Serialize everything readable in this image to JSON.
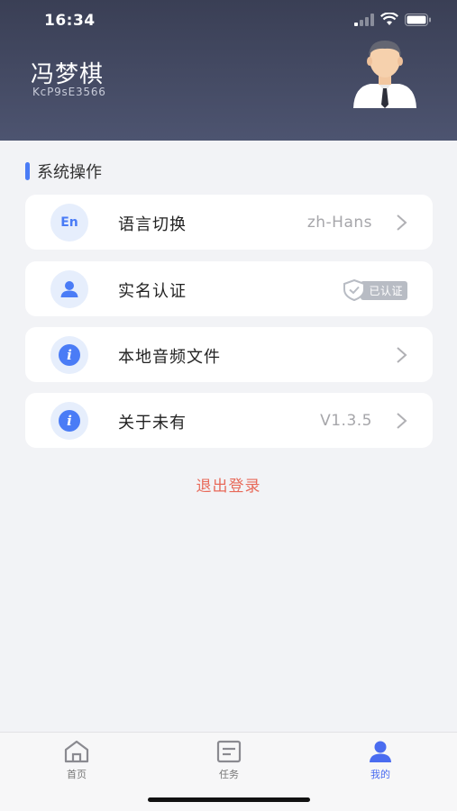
{
  "status_bar": {
    "time": "16:34"
  },
  "profile": {
    "name": "冯梦棋",
    "user_id": "KcP9sE3566"
  },
  "section": {
    "title": "系统操作"
  },
  "items": [
    {
      "icon": "language-icon",
      "icon_text": "En",
      "label": "语言切换",
      "value": "zh-Hans"
    },
    {
      "icon": "user-icon",
      "label": "实名认证",
      "badge": "已认证"
    },
    {
      "icon": "info-icon",
      "label": "本地音频文件"
    },
    {
      "icon": "info-icon",
      "label": "关于未有",
      "value": "V1.3.5"
    }
  ],
  "logout": {
    "label": "退出登录"
  },
  "tabs": [
    {
      "label": "首页",
      "icon": "home-icon",
      "active": false
    },
    {
      "label": "任务",
      "icon": "task-icon",
      "active": false
    },
    {
      "label": "我的",
      "icon": "profile-icon",
      "active": true
    }
  ],
  "colors": {
    "accent": "#4a7cf6",
    "header_bg": "#3a3f55",
    "logout": "#e86a5a",
    "active_tab": "#4a6cf0"
  }
}
